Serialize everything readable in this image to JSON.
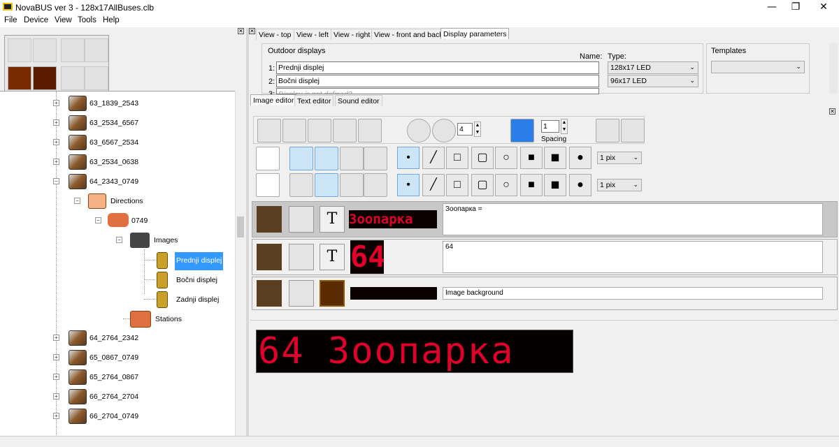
{
  "window": {
    "title": "NovaBUS ver 3 - 128x17AllBuses.clb",
    "minimize": "—",
    "restore": "❐",
    "close": "✕"
  },
  "menu": [
    "File",
    "Device",
    "View",
    "Tools",
    "Help"
  ],
  "tree": {
    "nodes": [
      {
        "label": "63_1839_2543"
      },
      {
        "label": "63_2534_6567"
      },
      {
        "label": "63_6567_2534"
      },
      {
        "label": "63_2534_0638"
      },
      {
        "label": "64_2343_0749"
      },
      {
        "label": "Directions"
      },
      {
        "label": "0749"
      },
      {
        "label": "Images"
      },
      {
        "label": "Prednji displej"
      },
      {
        "label": "Bočni displej"
      },
      {
        "label": "Zadnji displej"
      },
      {
        "label": "Stations"
      },
      {
        "label": "64_2764_2342"
      },
      {
        "label": "65_0867_0749"
      },
      {
        "label": "65_2764_0867"
      },
      {
        "label": "66_2764_2704"
      },
      {
        "label": "66_2704_0749"
      }
    ]
  },
  "top_tabs": [
    "View - top",
    "View - left",
    "View - right",
    "View - front and back",
    "Display parameters"
  ],
  "outdoor": {
    "group_label": "Outdoor displays",
    "name_header": "Name:",
    "type_header": "Type:",
    "rows": [
      {
        "num": "1:",
        "name": "Prednji displej",
        "type": "128x17 LED"
      },
      {
        "num": "2:",
        "name": "Bočni displej",
        "type": "96x17 LED"
      },
      {
        "num": "3:",
        "name": "Display is not defined?",
        "type": ""
      }
    ],
    "templates_label": "Templates"
  },
  "editor_tabs": [
    "Image editor",
    "Text editor",
    "Sound editor"
  ],
  "zoom": {
    "value": "4"
  },
  "spacing": {
    "value": "1",
    "label": "Spacing"
  },
  "pen_size": {
    "row1": "1 pix",
    "row2": "1 pix"
  },
  "content_rows": [
    {
      "led_text": "Зоопарка",
      "text": "Зоопарка ="
    },
    {
      "led_text": "64",
      "text": "64"
    },
    {
      "led_text": "",
      "text": "Image background"
    }
  ],
  "preview": {
    "text": "64  Зоопарка"
  },
  "colors": {
    "accent": "#3399ff",
    "led_red": "#e0002a"
  }
}
